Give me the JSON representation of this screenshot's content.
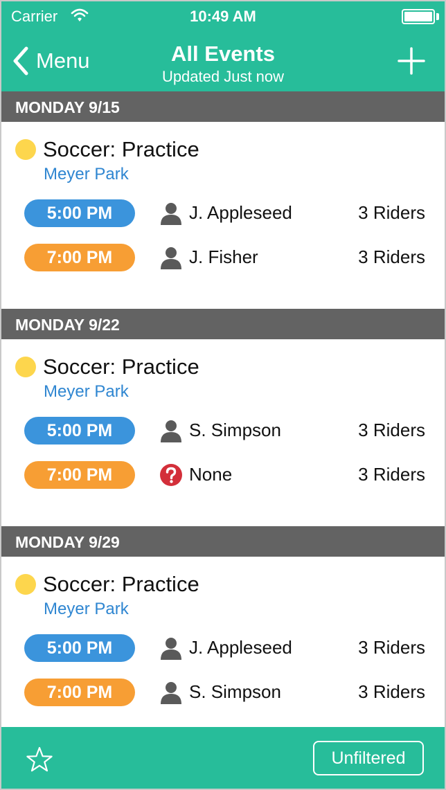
{
  "status_bar": {
    "carrier": "Carrier",
    "time": "10:49 AM"
  },
  "nav": {
    "back_label": "Menu",
    "title": "All Events",
    "subtitle": "Updated Just now",
    "back_icon": "chevron-left-icon",
    "add_icon": "plus-icon"
  },
  "colors": {
    "header_bg": "#27bd9a",
    "section_header_bg": "#636363",
    "event_dot": "#fdd64d",
    "location_link": "#2f86d1",
    "pill_blue": "#3b94dc",
    "pill_orange": "#f79e34",
    "warning_red": "#d32f3a"
  },
  "days": [
    {
      "date": "MONDAY 9/15",
      "event": {
        "title": "Soccer: Practice",
        "location": "Meyer Park"
      },
      "rides": [
        {
          "time": "5:00 PM",
          "color": "blue",
          "icon": "person-icon",
          "driver": "J. Appleseed",
          "riders": "3 Riders"
        },
        {
          "time": "7:00 PM",
          "color": "orange",
          "icon": "person-icon",
          "driver": "J. Fisher",
          "riders": "3 Riders"
        }
      ]
    },
    {
      "date": "MONDAY 9/22",
      "event": {
        "title": "Soccer: Practice",
        "location": "Meyer Park"
      },
      "rides": [
        {
          "time": "5:00 PM",
          "color": "blue",
          "icon": "person-icon",
          "driver": "S. Simpson",
          "riders": "3 Riders"
        },
        {
          "time": "7:00 PM",
          "color": "orange",
          "icon": "question-icon",
          "driver": "None",
          "riders": "3 Riders"
        }
      ]
    },
    {
      "date": "MONDAY 9/29",
      "event": {
        "title": "Soccer: Practice",
        "location": "Meyer Park"
      },
      "rides": [
        {
          "time": "5:00 PM",
          "color": "blue",
          "icon": "person-icon",
          "driver": "J. Appleseed",
          "riders": "3 Riders"
        },
        {
          "time": "7:00 PM",
          "color": "orange",
          "icon": "person-icon",
          "driver": "S. Simpson",
          "riders": "3 Riders"
        }
      ]
    }
  ],
  "footer": {
    "star_icon": "star-icon",
    "filter_label": "Unfiltered"
  }
}
